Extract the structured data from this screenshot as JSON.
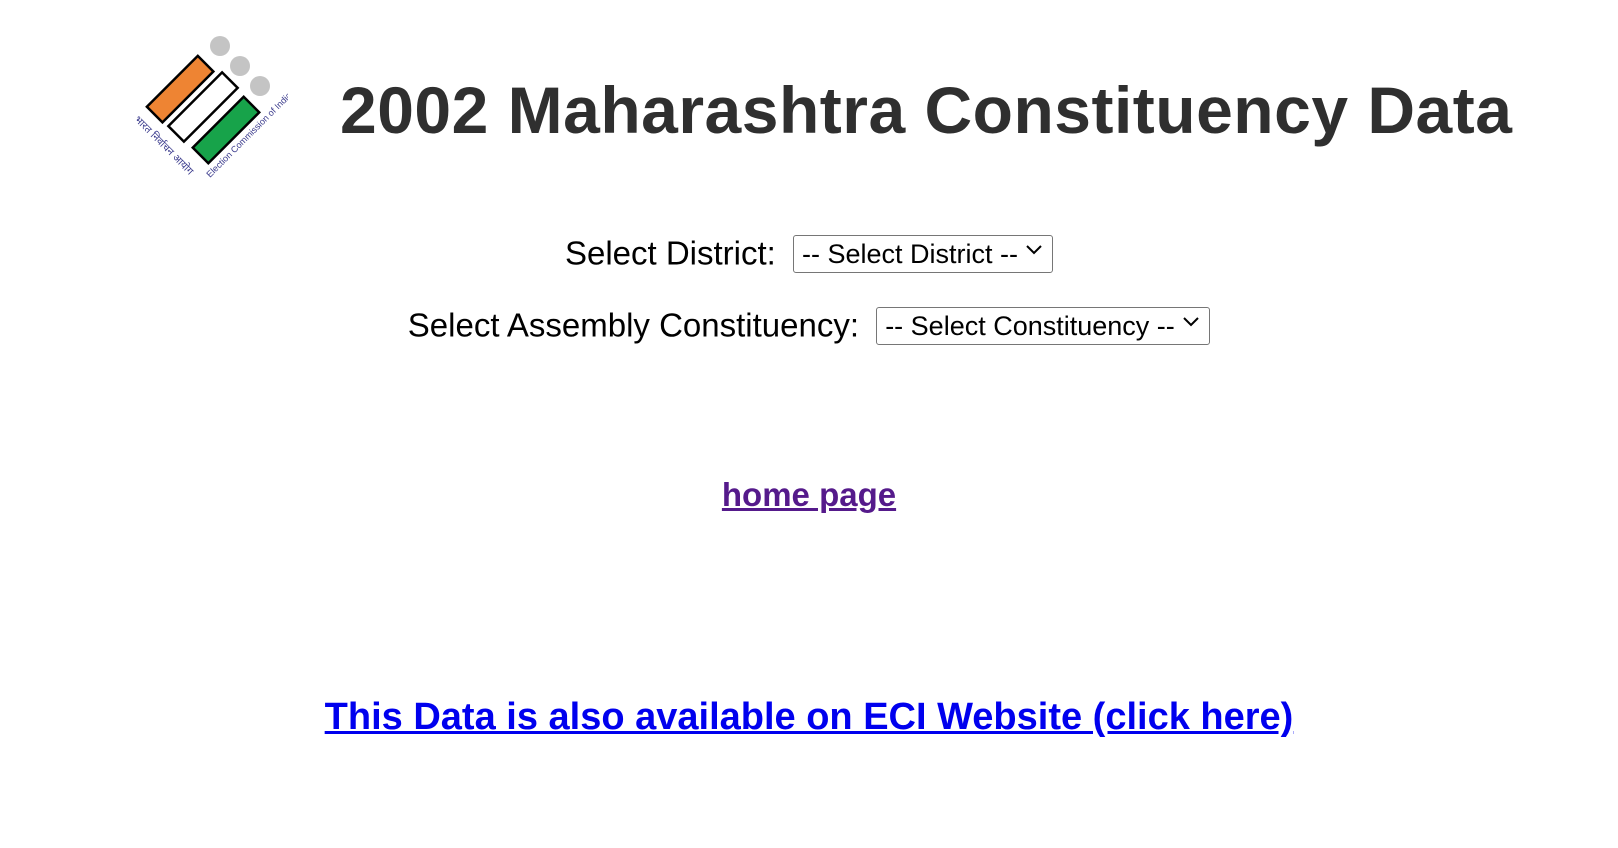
{
  "header": {
    "title": "2002 Maharashtra Constituency Data",
    "logo": {
      "icon": "election-commission-logo-icon",
      "text_hindi": "भारत निर्वाचन आयोग",
      "text_english": "Election Commission of India",
      "colors": {
        "saffron": "#ee8433",
        "white": "#ffffff",
        "green": "#17a34a",
        "dots": "#c4c4c4",
        "text": "#3a3a8c"
      }
    }
  },
  "form": {
    "district_label": "Select District:",
    "district_selected": "-- Select District --",
    "constituency_label": "Select Assembly Constituency:",
    "constituency_selected": "-- Select Constituency --"
  },
  "links": {
    "home": "home page",
    "eci": "This Data is also available on ECI Website (click here)",
    "visited_color": "#551a8b",
    "link_color": "#0000ee"
  }
}
